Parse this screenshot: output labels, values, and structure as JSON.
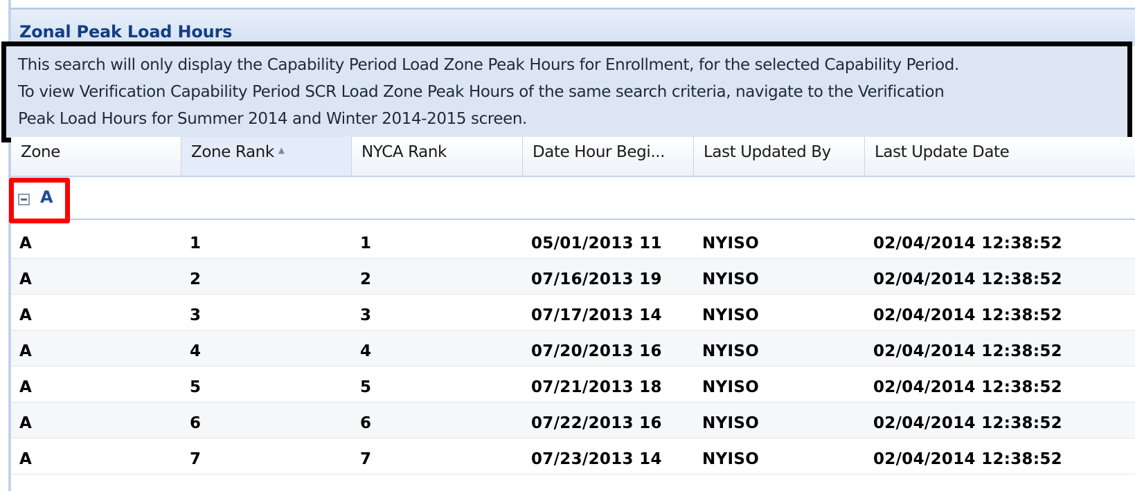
{
  "panel": {
    "title": "Zonal Peak Load Hours",
    "info_lines": [
      "This search will only display the Capability Period Load Zone Peak Hours for Enrollment, for the selected Capability Period.",
      "To view Verification Capability Period SCR Load Zone Peak Hours of the same search criteria, navigate to the Verification",
      "Peak Load Hours for Summer 2014 and Winter 2014-2015 screen."
    ]
  },
  "grid": {
    "columns": [
      {
        "label": "Zone",
        "sorted": false
      },
      {
        "label": "Zone Rank",
        "sorted": true,
        "sort_direction": "ascending"
      },
      {
        "label": "NYCA Rank",
        "sorted": false
      },
      {
        "label": "Date Hour Begi...",
        "sorted": false
      },
      {
        "label": "Last Updated By",
        "sorted": false
      },
      {
        "label": "Last Update Date",
        "sorted": false
      }
    ],
    "group": {
      "label": "A",
      "expanded": true,
      "highlight_color": "#ff0000"
    },
    "rows": [
      [
        "A",
        "1",
        "1",
        "05/01/2013 11",
        "NYISO",
        "02/04/2014 12:38:52"
      ],
      [
        "A",
        "2",
        "2",
        "07/16/2013 19",
        "NYISO",
        "02/04/2014 12:38:52"
      ],
      [
        "A",
        "3",
        "3",
        "07/17/2013 14",
        "NYISO",
        "02/04/2014 12:38:52"
      ],
      [
        "A",
        "4",
        "4",
        "07/20/2013 16",
        "NYISO",
        "02/04/2014 12:38:52"
      ],
      [
        "A",
        "5",
        "5",
        "07/21/2013 18",
        "NYISO",
        "02/04/2014 12:38:52"
      ],
      [
        "A",
        "6",
        "6",
        "07/22/2013 16",
        "NYISO",
        "02/04/2014 12:38:52"
      ],
      [
        "A",
        "7",
        "7",
        "07/23/2013 14",
        "NYISO",
        "02/04/2014 12:38:52"
      ]
    ]
  },
  "colors": {
    "title_text": "#153e82",
    "header_bg": "#d5e2f3",
    "info_bg": "#dce6f3",
    "info_border": "#000000",
    "group_label": "#1d4a9c"
  }
}
